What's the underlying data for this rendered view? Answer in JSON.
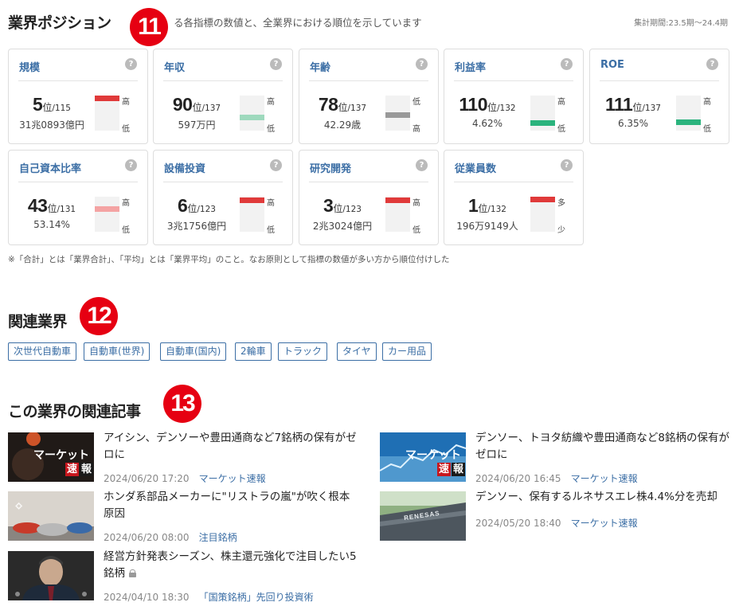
{
  "position": {
    "title": "業界ポジション",
    "badge": "11",
    "description": "る各指標の数値と、全業界における順位を示しています",
    "period": "集計期間:23.5期〜24.4期",
    "help_glyph": "?",
    "cards": [
      {
        "label": "規模",
        "rank": "5",
        "unit": "位",
        "total": "/115",
        "sub": "31兆0893億円",
        "top": "高",
        "bottom": "低",
        "level": 0.0,
        "color": "#e03a3a"
      },
      {
        "label": "年収",
        "rank": "90",
        "unit": "位",
        "total": "/137",
        "sub": "597万円",
        "top": "高",
        "bottom": "低",
        "level": 0.66,
        "color": "#9ed9bd"
      },
      {
        "label": "年齢",
        "rank": "78",
        "unit": "位",
        "total": "/137",
        "sub": "42.29歳",
        "top": "低",
        "bottom": "高",
        "level": 0.57,
        "color": "#999999"
      },
      {
        "label": "利益率",
        "rank": "110",
        "unit": "位",
        "total": "/132",
        "sub": "4.62%",
        "top": "高",
        "bottom": "低",
        "level": 0.83,
        "color": "#2bb37d"
      },
      {
        "label": "ROE",
        "rank": "111",
        "unit": "位",
        "total": "/137",
        "sub": "6.35%",
        "top": "高",
        "bottom": "低",
        "level": 0.81,
        "color": "#2bb37d"
      },
      {
        "label": "自己資本比率",
        "rank": "43",
        "unit": "位",
        "total": "/131",
        "sub": "53.14%",
        "top": "高",
        "bottom": "低",
        "level": 0.33,
        "color": "#f4a3a3"
      },
      {
        "label": "設備投資",
        "rank": "6",
        "unit": "位",
        "total": "/123",
        "sub": "3兆1756億円",
        "top": "高",
        "bottom": "低",
        "level": 0.04,
        "color": "#e03a3a"
      },
      {
        "label": "研究開発",
        "rank": "3",
        "unit": "位",
        "total": "/123",
        "sub": "2兆3024億円",
        "top": "高",
        "bottom": "低",
        "level": 0.02,
        "color": "#e03a3a"
      },
      {
        "label": "従業員数",
        "rank": "1",
        "unit": "位",
        "total": "/132",
        "sub": "196万9149人",
        "top": "多",
        "bottom": "少",
        "level": 0.0,
        "color": "#e03a3a"
      }
    ],
    "note": "※「合計」とは「業界合計」、「平均」とは「業界平均」のこと。なお原則として指標の数値が多い方から順位付けした"
  },
  "related": {
    "title": "関連業界",
    "badge": "12",
    "tags": [
      "次世代自動車",
      "自動車(世界)",
      "自動車(国内)",
      "2輪車",
      "トラック",
      "タイヤ",
      "カー用品"
    ]
  },
  "articles": {
    "title": "この業界の関連記事",
    "badge": "13",
    "thumb_text": {
      "market": "マーケット",
      "speed": "速",
      "report": "報",
      "renesas": "RENESAS"
    },
    "items": [
      {
        "title": "アイシン、デンソーや豊田通商など7銘柄の保有がゼロに",
        "date": "2024/06/20 17:20",
        "category": "マーケット速報",
        "thumb": "market-dark",
        "locked": false
      },
      {
        "title": "デンソー、トヨタ紡織や豊田通商など8銘柄の保有がゼロに",
        "date": "2024/06/20 16:45",
        "category": "マーケット速報",
        "thumb": "market-blue",
        "locked": false
      },
      {
        "title": "ホンダ系部品メーカーに\"リストラの嵐\"が吹く根本原因",
        "date": "2024/06/20 08:00",
        "category": "注目銘柄",
        "thumb": "cars",
        "locked": false
      },
      {
        "title": "デンソー、保有するルネサスエレ株4.4%分を売却",
        "date": "2024/05/20 18:40",
        "category": "マーケット速報",
        "thumb": "renesas",
        "locked": false
      },
      {
        "title": "経営方針発表シーズン、株主還元強化で注目したい5銘柄",
        "date": "2024/04/10 18:30",
        "category": "「国策銘柄」先回り投資術",
        "thumb": "person",
        "locked": true
      }
    ]
  }
}
